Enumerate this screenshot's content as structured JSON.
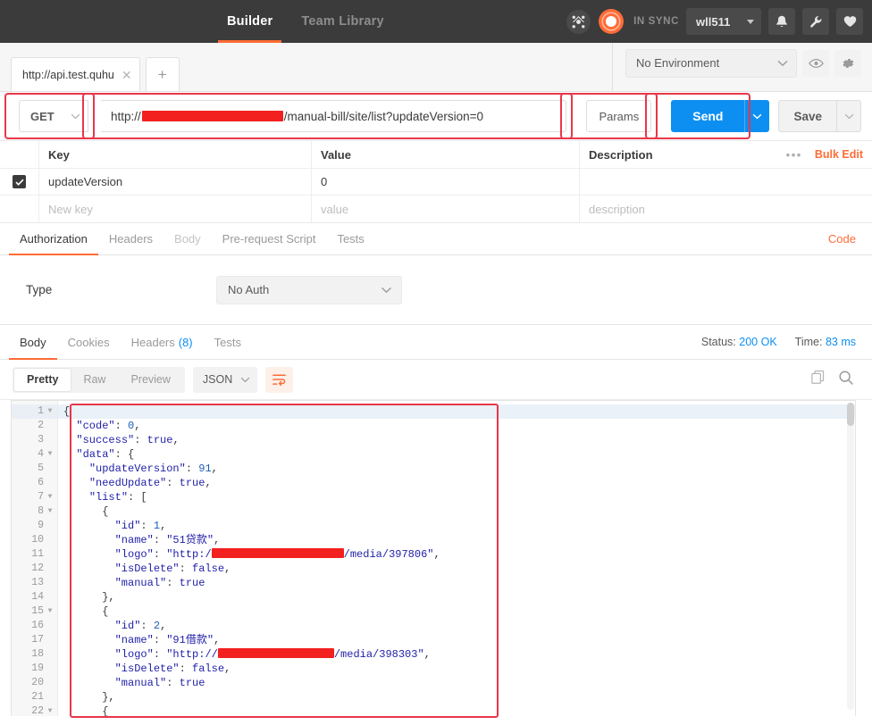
{
  "topbar": {
    "tabs": [
      {
        "label": "Builder",
        "active": true
      },
      {
        "label": "Team Library",
        "active": false
      }
    ],
    "sync_label": "IN SYNC",
    "user": "wll511",
    "accent": "#ff6c37",
    "bg": "#3b3b3b"
  },
  "tabstrip": {
    "request_tab": "http://api.test.quhu",
    "new_tab": "+",
    "environment": "No Environment"
  },
  "url_row": {
    "method": "GET",
    "url_prefix": "http://",
    "url_suffix": "/manual-bill/site/list?updateVersion=0",
    "params_label": "Params",
    "send_label": "Send",
    "save_label": "Save"
  },
  "params_table": {
    "headers": [
      "Key",
      "Value",
      "Description"
    ],
    "bulk_edit": "Bulk Edit",
    "more": "•••",
    "rows": [
      {
        "checked": true,
        "key": "updateVersion",
        "value": "0",
        "description": ""
      }
    ],
    "placeholder_row": {
      "key": "New key",
      "value": "value",
      "description": "description"
    }
  },
  "request_tabs": {
    "items": [
      {
        "label": "Authorization",
        "active": true,
        "dim": false
      },
      {
        "label": "Headers",
        "active": false,
        "dim": false
      },
      {
        "label": "Body",
        "active": false,
        "dim": true
      },
      {
        "label": "Pre-request Script",
        "active": false,
        "dim": false
      },
      {
        "label": "Tests",
        "active": false,
        "dim": false
      }
    ],
    "code_label": "Code"
  },
  "auth": {
    "type_label": "Type",
    "type_value": "No Auth"
  },
  "response": {
    "tabs": [
      {
        "label": "Body",
        "active": true,
        "count": ""
      },
      {
        "label": "Cookies",
        "active": false,
        "count": ""
      },
      {
        "label": "Headers",
        "active": false,
        "count": "(8)"
      },
      {
        "label": "Tests",
        "active": false,
        "count": ""
      }
    ],
    "status_label": "Status:",
    "status_value": "200 OK",
    "time_label": "Time:",
    "time_value": "83 ms"
  },
  "viewbar": {
    "modes": [
      {
        "label": "Pretty",
        "active": true
      },
      {
        "label": "Raw",
        "active": false
      },
      {
        "label": "Preview",
        "active": false
      }
    ],
    "format": "JSON",
    "wrap_icon": "wrap-lines-icon",
    "copy_icon": "copy-icon",
    "search_icon": "search-icon"
  },
  "code": {
    "lines": [
      {
        "n": 1,
        "fold": true,
        "indent": 0,
        "tokens": [
          {
            "t": "p",
            "v": "{"
          }
        ]
      },
      {
        "n": 2,
        "fold": false,
        "indent": 1,
        "tokens": [
          {
            "t": "k",
            "v": "\"code\""
          },
          {
            "t": "p",
            "v": ": "
          },
          {
            "t": "n",
            "v": "0"
          },
          {
            "t": "p",
            "v": ","
          }
        ]
      },
      {
        "n": 3,
        "fold": false,
        "indent": 1,
        "tokens": [
          {
            "t": "k",
            "v": "\"success\""
          },
          {
            "t": "p",
            "v": ": "
          },
          {
            "t": "b",
            "v": "true"
          },
          {
            "t": "p",
            "v": ","
          }
        ]
      },
      {
        "n": 4,
        "fold": true,
        "indent": 1,
        "tokens": [
          {
            "t": "k",
            "v": "\"data\""
          },
          {
            "t": "p",
            "v": ": {"
          }
        ]
      },
      {
        "n": 5,
        "fold": false,
        "indent": 2,
        "tokens": [
          {
            "t": "k",
            "v": "\"updateVersion\""
          },
          {
            "t": "p",
            "v": ": "
          },
          {
            "t": "n",
            "v": "91"
          },
          {
            "t": "p",
            "v": ","
          }
        ]
      },
      {
        "n": 6,
        "fold": false,
        "indent": 2,
        "tokens": [
          {
            "t": "k",
            "v": "\"needUpdate\""
          },
          {
            "t": "p",
            "v": ": "
          },
          {
            "t": "b",
            "v": "true"
          },
          {
            "t": "p",
            "v": ","
          }
        ]
      },
      {
        "n": 7,
        "fold": true,
        "indent": 2,
        "tokens": [
          {
            "t": "k",
            "v": "\"list\""
          },
          {
            "t": "p",
            "v": ": ["
          }
        ]
      },
      {
        "n": 8,
        "fold": true,
        "indent": 3,
        "tokens": [
          {
            "t": "p",
            "v": "{"
          }
        ]
      },
      {
        "n": 9,
        "fold": false,
        "indent": 4,
        "tokens": [
          {
            "t": "k",
            "v": "\"id\""
          },
          {
            "t": "p",
            "v": ": "
          },
          {
            "t": "n",
            "v": "1"
          },
          {
            "t": "p",
            "v": ","
          }
        ]
      },
      {
        "n": 10,
        "fold": false,
        "indent": 4,
        "tokens": [
          {
            "t": "k",
            "v": "\"name\""
          },
          {
            "t": "p",
            "v": ": "
          },
          {
            "t": "s",
            "v": "\"51贷款\""
          },
          {
            "t": "p",
            "v": ","
          }
        ]
      },
      {
        "n": 11,
        "fold": false,
        "indent": 4,
        "tokens": [
          {
            "t": "k",
            "v": "\"logo\""
          },
          {
            "t": "p",
            "v": ": "
          },
          {
            "t": "s",
            "v": "\"http:/"
          },
          {
            "t": "redact",
            "v": "148"
          },
          {
            "t": "s",
            "v": "/media/397806\""
          },
          {
            "t": "p",
            "v": ","
          }
        ]
      },
      {
        "n": 12,
        "fold": false,
        "indent": 4,
        "tokens": [
          {
            "t": "k",
            "v": "\"isDelete\""
          },
          {
            "t": "p",
            "v": ": "
          },
          {
            "t": "b",
            "v": "false"
          },
          {
            "t": "p",
            "v": ","
          }
        ]
      },
      {
        "n": 13,
        "fold": false,
        "indent": 4,
        "tokens": [
          {
            "t": "k",
            "v": "\"manual\""
          },
          {
            "t": "p",
            "v": ": "
          },
          {
            "t": "b",
            "v": "true"
          }
        ]
      },
      {
        "n": 14,
        "fold": false,
        "indent": 3,
        "tokens": [
          {
            "t": "p",
            "v": "},"
          }
        ]
      },
      {
        "n": 15,
        "fold": true,
        "indent": 3,
        "tokens": [
          {
            "t": "p",
            "v": "{"
          }
        ]
      },
      {
        "n": 16,
        "fold": false,
        "indent": 4,
        "tokens": [
          {
            "t": "k",
            "v": "\"id\""
          },
          {
            "t": "p",
            "v": ": "
          },
          {
            "t": "n",
            "v": "2"
          },
          {
            "t": "p",
            "v": ","
          }
        ]
      },
      {
        "n": 17,
        "fold": false,
        "indent": 4,
        "tokens": [
          {
            "t": "k",
            "v": "\"name\""
          },
          {
            "t": "p",
            "v": ": "
          },
          {
            "t": "s",
            "v": "\"91借款\""
          },
          {
            "t": "p",
            "v": ","
          }
        ]
      },
      {
        "n": 18,
        "fold": false,
        "indent": 4,
        "tokens": [
          {
            "t": "k",
            "v": "\"logo\""
          },
          {
            "t": "p",
            "v": ": "
          },
          {
            "t": "s",
            "v": "\"http://"
          },
          {
            "t": "redact",
            "v": "130"
          },
          {
            "t": "s",
            "v": "/media/398303\""
          },
          {
            "t": "p",
            "v": ","
          }
        ]
      },
      {
        "n": 19,
        "fold": false,
        "indent": 4,
        "tokens": [
          {
            "t": "k",
            "v": "\"isDelete\""
          },
          {
            "t": "p",
            "v": ": "
          },
          {
            "t": "b",
            "v": "false"
          },
          {
            "t": "p",
            "v": ","
          }
        ]
      },
      {
        "n": 20,
        "fold": false,
        "indent": 4,
        "tokens": [
          {
            "t": "k",
            "v": "\"manual\""
          },
          {
            "t": "p",
            "v": ": "
          },
          {
            "t": "b",
            "v": "true"
          }
        ]
      },
      {
        "n": 21,
        "fold": false,
        "indent": 3,
        "tokens": [
          {
            "t": "p",
            "v": "},"
          }
        ]
      },
      {
        "n": 22,
        "fold": true,
        "indent": 3,
        "tokens": [
          {
            "t": "p",
            "v": "{"
          }
        ]
      }
    ]
  },
  "annotation_color": "#e8374a"
}
